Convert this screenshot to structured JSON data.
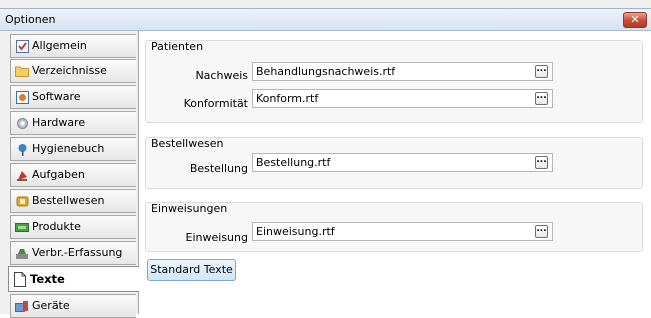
{
  "window": {
    "title": "Optionen",
    "close_glyph": "✕"
  },
  "sidebar": {
    "items": [
      {
        "label": "Allgemein",
        "icon": "checkbox-icon",
        "color": "#c23b3b"
      },
      {
        "label": "Verzeichnisse",
        "icon": "folder-icon",
        "color": "#e6b43a"
      },
      {
        "label": "Software",
        "icon": "software-icon",
        "color": "#e07a1f"
      },
      {
        "label": "Hardware",
        "icon": "gear-icon",
        "color": "#8a8a8a"
      },
      {
        "label": "Hygienebuch",
        "icon": "pin-icon",
        "color": "#3b7fd1"
      },
      {
        "label": "Aufgaben",
        "icon": "task-icon",
        "color": "#c2362c"
      },
      {
        "label": "Bestellwesen",
        "icon": "cart-icon",
        "color": "#d89a1a"
      },
      {
        "label": "Produkte",
        "icon": "products-icon",
        "color": "#3a9a3a"
      },
      {
        "label": "Verbr.-Erfassung",
        "icon": "capture-icon",
        "color": "#4a8a3a"
      },
      {
        "label": "Texte",
        "icon": "document-icon",
        "color": "#555555",
        "active": true
      },
      {
        "label": "Geräte",
        "icon": "devices-icon",
        "color": "#3a6ab0"
      }
    ]
  },
  "main": {
    "groups": [
      {
        "title": "Patienten",
        "fields": [
          {
            "label": "Nachweis",
            "value": "Behandlungsnachweis.rtf"
          },
          {
            "label": "Konformität",
            "value": "Konform.rtf"
          }
        ]
      },
      {
        "title": "Bestellwesen",
        "fields": [
          {
            "label": "Bestellung",
            "value": "Bestellung.rtf"
          }
        ]
      },
      {
        "title": "Einweisungen",
        "fields": [
          {
            "label": "Einweisung",
            "value": "Einweisung.rtf"
          }
        ]
      }
    ],
    "browse_glyph": "...",
    "standard_button": "Standard Texte"
  }
}
